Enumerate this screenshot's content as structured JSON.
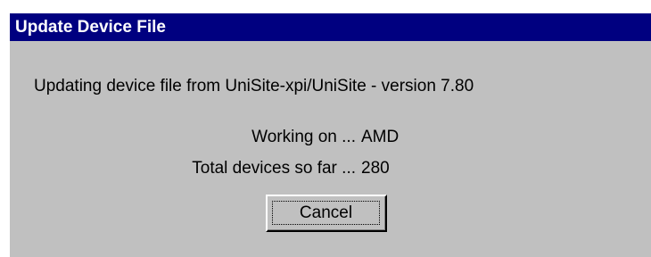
{
  "dialog": {
    "title": "Update Device File",
    "message": "Updating device file from UniSite-xpi/UniSite - version 7.80",
    "working_label": "Working on ...",
    "working_value": "AMD",
    "total_label": "Total devices so far ...",
    "total_value": "280",
    "cancel_label": "Cancel"
  },
  "colors": {
    "titlebar": "#000080",
    "face": "#c0c0c0",
    "title_text": "#ffffff"
  }
}
